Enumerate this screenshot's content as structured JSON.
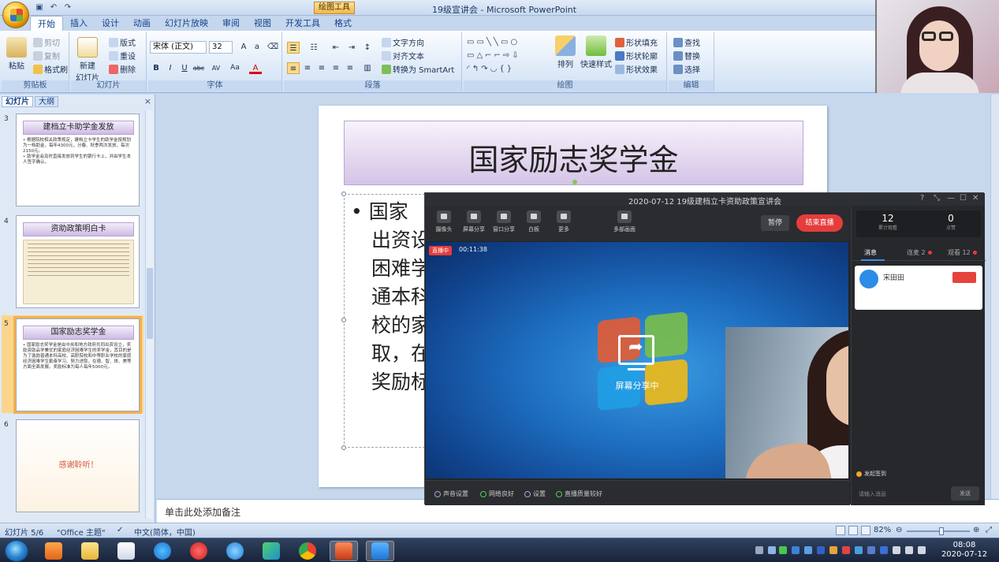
{
  "app": {
    "context_tab": "绘图工具",
    "window_title": "19级宣讲会 - Microsoft PowerPoint"
  },
  "ribbon": {
    "tabs": [
      "开始",
      "插入",
      "设计",
      "动画",
      "幻灯片放映",
      "审阅",
      "视图",
      "开发工具",
      "格式"
    ],
    "clipboard": {
      "paste": "粘贴",
      "cut": "剪切",
      "copy": "复制",
      "format_painter": "格式刷",
      "label": "剪贴板"
    },
    "slides": {
      "new_slide": "新建\n幻灯片",
      "layout": "版式",
      "reset": "重设",
      "delete": "删除",
      "label": "幻灯片"
    },
    "font": {
      "name": "宋体 (正文)",
      "size": "32",
      "label": "字体",
      "bold": "B",
      "italic": "I",
      "underline": "U",
      "strike": "abc",
      "spacing": "AV",
      "case": "Aa",
      "color": "A"
    },
    "paragraph": {
      "text_direction": "文字方向",
      "align_text": "对齐文本",
      "smartart": "转换为 SmartArt",
      "label": "段落"
    },
    "drawing": {
      "arrange": "排列",
      "quick_styles": "快速样式",
      "shape_fill": "形状填充",
      "shape_outline": "形状轮廓",
      "shape_effects": "形状效果",
      "label": "绘图"
    },
    "editing": {
      "find": "查找",
      "replace": "替换",
      "select": "选择",
      "label": "编辑"
    }
  },
  "left_pane": {
    "tabs": [
      "幻灯片",
      "大纲"
    ],
    "close": "×",
    "thumbnails": [
      {
        "num": "3",
        "title": "建档立卡助学金发放",
        "body": "• 根据院校相关政策规定，建档立卡学生的助学金按规划为一档助金，每年4300元，分春、秋季两次发放，每次2150元。\n• 助学金会及时直接发放到学生的银行卡上，并由学生本人签字确认。"
      },
      {
        "num": "4",
        "title": "资助政策明白卡",
        "body": ""
      },
      {
        "num": "5",
        "title": "国家励志奖学金",
        "body": "• 国家励志奖学金是由中央和地方政府共同出资设立，奖励资助品学兼优的家庭经济困难学生的奖学金，其目的是为了激励普通本科高校、高职院校和中等职业学校的家庭经济困难学生勤奋学习、努力进取，在德、智、体、美等方面全面发展。奖励标准为每人每年5000元。"
      },
      {
        "num": "6",
        "title": "感谢聆听！",
        "body": ""
      }
    ]
  },
  "slide": {
    "title": "国家励志奖学金",
    "lines": [
      "•  国家",
      "出资设",
      "困难学",
      "通本科",
      "校的家",
      "取，在",
      "奖励标"
    ]
  },
  "notes_placeholder": "单击此处添加备注",
  "status": {
    "slide_counter": "幻灯片 5/6",
    "theme": "\"Office 主题\"",
    "language": "中文(简体，中国)",
    "zoom": "82%",
    "zoom_fraction": 0.55
  },
  "live": {
    "title": "2020-07-12    19级建档立卡资助政策宣讲会",
    "toolbar": [
      "摄像头",
      "屏幕分享",
      "窗口分享",
      "白板",
      "更多",
      "多部画面"
    ],
    "pause": "暂停",
    "end": "结束直播",
    "badge": "直播中",
    "elapsed": "00:11:38",
    "share_text": "屏幕分享中",
    "stats": [
      {
        "value": "12",
        "label": "累计观看"
      },
      {
        "value": "0",
        "label": "点赞"
      }
    ],
    "side_tabs": [
      "消息",
      "连麦 2",
      "观看 12"
    ],
    "msg_name": "宋田田",
    "gift": "发起签到",
    "input_placeholder": "请输入消息",
    "send": "发送",
    "bottom": [
      "声音设置",
      "网络良好",
      "设置",
      "直播质量较好"
    ]
  },
  "taskbar": {
    "time": "08:08",
    "date": "2020-07-12"
  },
  "colors": {
    "ribbon_blue": "#dbe8f7",
    "slide_title_purple": "#d5c4e7",
    "live_end_red": "#e63c3c",
    "selection_orange": "#f4b14e"
  }
}
